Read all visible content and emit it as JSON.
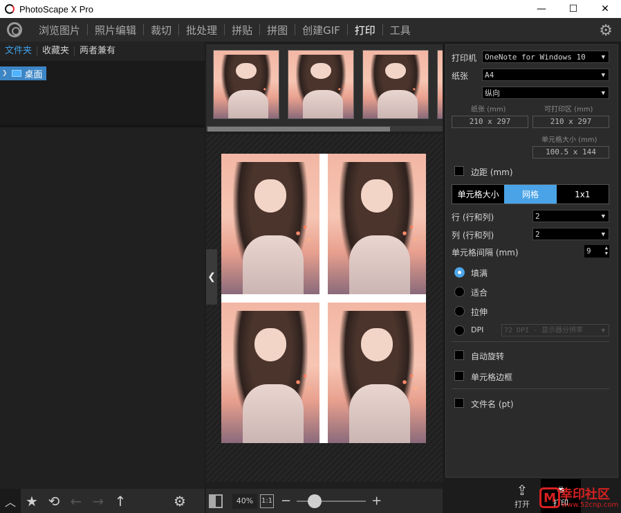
{
  "window": {
    "title": "PhotoScape X Pro",
    "minimize": "—",
    "maximize": "☐",
    "close": "✕"
  },
  "menu": {
    "items": [
      "浏览图片",
      "照片编辑",
      "裁切",
      "批处理",
      "拼贴",
      "拼图",
      "创建GIF",
      "打印",
      "工具"
    ],
    "active": "打印"
  },
  "left": {
    "tabs": [
      "文件夹",
      "收藏夹",
      "两者兼有"
    ],
    "active_tab": "文件夹",
    "tree": [
      {
        "label": "桌面",
        "selected": true
      }
    ]
  },
  "bottom_left": {
    "icons": [
      "chevron-up-icon",
      "star-icon",
      "refresh-icon",
      "back-arrow-icon",
      "forward-arrow-icon",
      "up-arrow-icon",
      "gear-icon"
    ]
  },
  "thumbnails": {
    "count_visible": 3,
    "scroll_fraction": 0.78
  },
  "preview": {
    "rows": 2,
    "cols": 2
  },
  "zoom": {
    "value": "40%",
    "one_to_one": "1:1",
    "minus": "−",
    "plus": "+",
    "slider_fraction": 0.16
  },
  "print": {
    "printer_label": "打印机",
    "printer_value": "OneNote for Windows 10",
    "paper_label": "纸张",
    "paper_value": "A4",
    "orientation_value": "纵向",
    "paper_size_label": "纸张 (mm)",
    "paper_size_value": "210 x 297",
    "printable_label": "可打印区 (mm)",
    "printable_value": "210 x 297",
    "cell_size_label": "单元格大小 (mm)",
    "cell_size_value": "100.5 x 144",
    "margin_label": "边距 (mm)",
    "margin_checked": false,
    "mode_tabs": [
      "单元格大小",
      "网格",
      "1x1"
    ],
    "mode_active": "网格",
    "rows_label": "行 (行和列)",
    "rows_value": "2",
    "cols_label": "列 (行和列)",
    "cols_value": "2",
    "spacing_label": "单元格间隔 (mm)",
    "spacing_value": "9",
    "fit_options": [
      "填满",
      "适合",
      "拉伸",
      "DPI"
    ],
    "fit_selected": "填满",
    "dpi_value": "72 DPI - 显示器分辨率",
    "auto_rotate_label": "自动旋转",
    "cell_border_label": "单元格边框",
    "filename_label": "文件名 (pt)"
  },
  "bottom_right": {
    "open_label": "打开",
    "print_label": "打印",
    "watermark_text": "幸印社区",
    "watermark_url": "www.52cnp.com"
  },
  "colors": {
    "accent": "#4aa3e6",
    "tab_active": "#3fa0e8",
    "background": "#1c1c1c",
    "panel": "#2b2b2b"
  }
}
